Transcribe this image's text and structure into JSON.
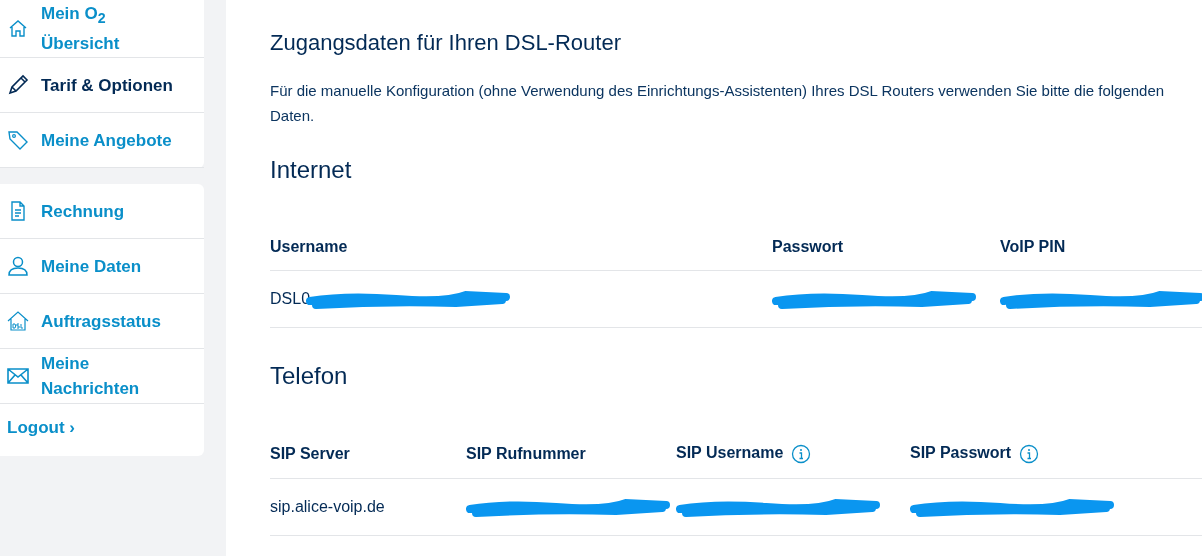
{
  "sidebar": {
    "groups": [
      {
        "items": [
          {
            "label": "Mein O$_{2}$ Übersicht",
            "selected": false
          },
          {
            "label": "Tarif & Optionen",
            "selected": true
          },
          {
            "label": "Meine Angebote",
            "selected": false
          }
        ]
      },
      {
        "items": [
          {
            "label": "Rechnung",
            "selected": false
          },
          {
            "label": "Meine Daten",
            "selected": false
          },
          {
            "label": "Auftragsstatus",
            "selected": false
          },
          {
            "label": "Meine Nachrichten",
            "selected": false
          }
        ],
        "logout": {
          "label": "Logout",
          "chevron": "›"
        }
      }
    ]
  },
  "content": {
    "title": "Zugangsdaten für Ihren DSL-Router",
    "intro": "Für die manuelle Konfiguration (ohne Verwendung des Einrichtungs-Assistenten) Ihres DSL Routers verwenden Sie bitte die folgenden Daten.",
    "sections": [
      {
        "heading": "Internet",
        "columns": [
          {
            "label": "Username",
            "info": false
          },
          {
            "label": "Passwort",
            "info": false
          },
          {
            "label": "VoIP PIN",
            "info": false
          }
        ],
        "rows": [
          [
            {
              "value": "DSL0",
              "redacted": true
            },
            {
              "redacted": true
            },
            {
              "redacted": true
            }
          ]
        ]
      },
      {
        "heading": "Telefon",
        "columns": [
          {
            "label": "SIP Server",
            "info": false
          },
          {
            "label": "SIP Rufnummer",
            "info": false
          },
          {
            "label": "SIP Username",
            "info": true
          },
          {
            "label": "SIP Passwort",
            "info": true
          }
        ],
        "rows": [
          [
            {
              "value": "sip.alice-voip.de",
              "redacted": false
            },
            {
              "redacted": true
            },
            {
              "redacted": true
            },
            {
              "redacted": true
            }
          ]
        ]
      }
    ]
  }
}
